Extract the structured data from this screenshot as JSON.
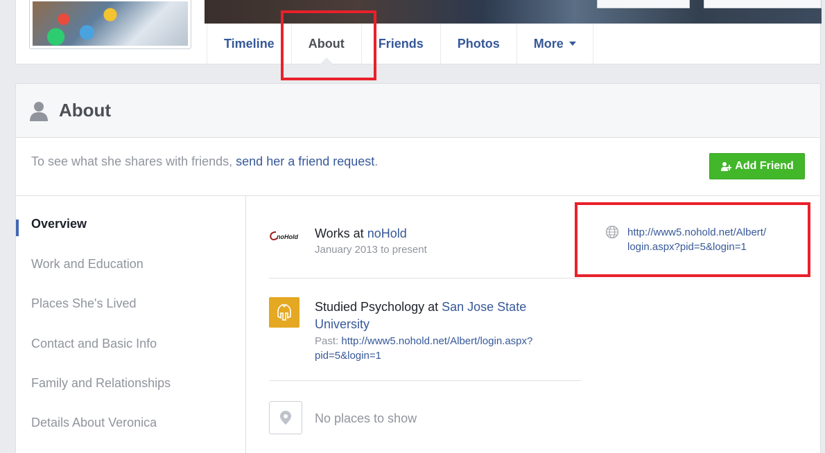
{
  "tabs": {
    "timeline": "Timeline",
    "about": "About",
    "friends": "Friends",
    "photos": "Photos",
    "more": "More"
  },
  "about": {
    "title": "About",
    "friend_msg_prefix": "To see what she shares with friends, ",
    "friend_msg_link": "send her a friend request",
    "friend_msg_suffix": ".",
    "add_friend_label": "Add Friend"
  },
  "nav": {
    "items": [
      "Overview",
      "Work and Education",
      "Places She's Lived",
      "Contact and Basic Info",
      "Family and Relationships",
      "Details About Veronica"
    ]
  },
  "work": {
    "logo_text": "noHold",
    "prefix": "Works at ",
    "company": "noHold",
    "dates": "January 2013 to present",
    "website_line1": "http://www5.nohold.net/Albert/",
    "website_line2": "login.aspx?pid=5&login=1"
  },
  "education": {
    "prefix": "Studied Psychology at ",
    "school_line1": "San Jose State",
    "school_line2": "University",
    "past_label": "Past: ",
    "past_link_line1": "http://www5.nohold.net/Albert/login.aspx?",
    "past_link_line2": "pid=5&login=1"
  },
  "places": {
    "empty_text": "No places to show"
  },
  "colors": {
    "link": "#365899",
    "highlight": "#e8212b",
    "add_friend": "#42b72a",
    "sjsu_gold": "#e5a823"
  }
}
